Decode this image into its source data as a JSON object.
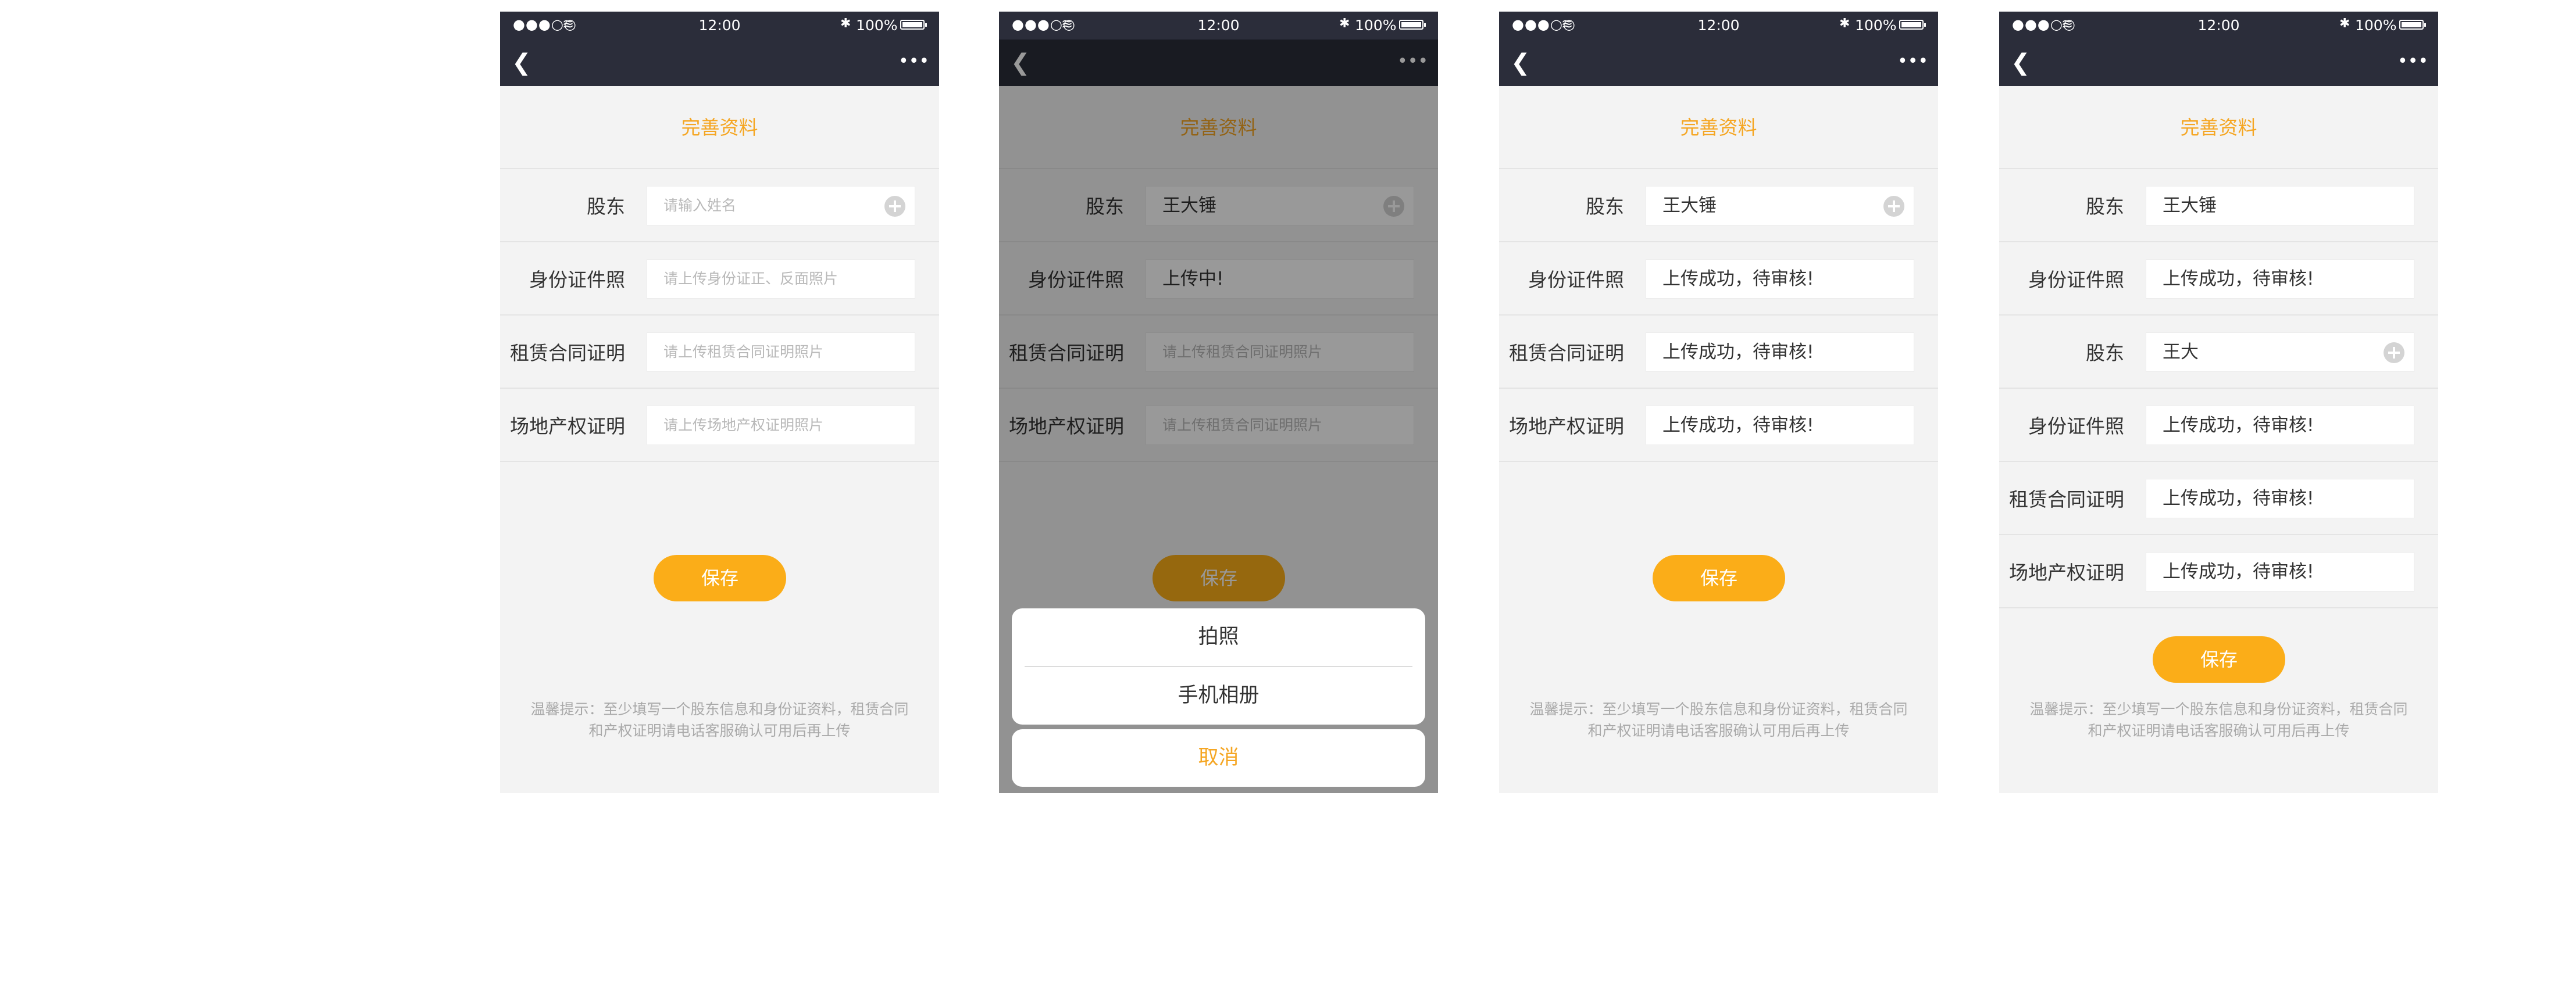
{
  "status_bar": {
    "signal": "●●●○○",
    "wifi": "≋",
    "time": "12:00",
    "bluetooth": "✱",
    "battery": "100%"
  },
  "icons": {
    "back": "chevron-left",
    "more": "ellipsis",
    "add": "plus-circle"
  },
  "colors": {
    "accent": "#f5a623",
    "button": "#fbad18",
    "navbar": "#2b2d3a"
  },
  "screens": [
    {
      "title": "完善资料",
      "rows": [
        {
          "label": "股东",
          "value": "请输入姓名",
          "placeholder": true,
          "add_icon": true
        },
        {
          "label": "身份证件照",
          "value": "请上传身份证正、反面照片",
          "placeholder": true
        },
        {
          "label": "租赁合同证明",
          "value": "请上传租赁合同证明照片",
          "placeholder": true
        },
        {
          "label": "场地产权证明",
          "value": "请上传场地产权证明照片",
          "placeholder": true
        }
      ],
      "save": "保存",
      "tip_line1": "温馨提示：至少填写一个股东信息和身份证资料，租赁合同",
      "tip_line2": "和产权证明请电话客服确认可用后再上传"
    },
    {
      "title": "完善资料",
      "rows": [
        {
          "label": "股东",
          "value": "王大锤",
          "add_icon": true
        },
        {
          "label": "身份证件照",
          "value": "上传中!"
        },
        {
          "label": "租赁合同证明",
          "value": "请上传租赁合同证明照片",
          "placeholder": true
        },
        {
          "label": "场地产权证明",
          "value": "请上传租赁合同证明照片",
          "placeholder": true
        }
      ],
      "save": "保存",
      "sheet": {
        "option1": "拍照",
        "option2": "手机相册",
        "cancel": "取消"
      }
    },
    {
      "title": "完善资料",
      "rows": [
        {
          "label": "股东",
          "value": "王大锤",
          "add_icon": true
        },
        {
          "label": "身份证件照",
          "value": "上传成功，待审核!"
        },
        {
          "label": "租赁合同证明",
          "value": "上传成功，待审核!"
        },
        {
          "label": "场地产权证明",
          "value": "上传成功，待审核!"
        }
      ],
      "save": "保存",
      "tip_line1": "温馨提示：至少填写一个股东信息和身份证资料，租赁合同",
      "tip_line2": "和产权证明请电话客服确认可用后再上传"
    },
    {
      "title": "完善资料",
      "rows": [
        {
          "label": "股东",
          "value": "王大锤"
        },
        {
          "label": "身份证件照",
          "value": "上传成功，待审核!"
        },
        {
          "label": "股东",
          "value": "王大",
          "add_icon": true
        },
        {
          "label": "身份证件照",
          "value": "上传成功，待审核!"
        },
        {
          "label": "租赁合同证明",
          "value": "上传成功，待审核!"
        },
        {
          "label": "场地产权证明",
          "value": "上传成功，待审核!"
        }
      ],
      "save": "保存",
      "tip_line1": "温馨提示：至少填写一个股东信息和身份证资料，租赁合同",
      "tip_line2": "和产权证明请电话客服确认可用后再上传"
    }
  ]
}
